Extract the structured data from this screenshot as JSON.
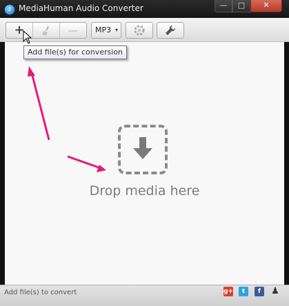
{
  "window": {
    "title": "MediaHuman Audio Converter",
    "controls": {
      "minimize": "—",
      "maximize": "□",
      "close": "✕"
    }
  },
  "toolbar": {
    "add_icon": "+",
    "clear_icon": "🧹",
    "remove_icon": "—",
    "format_value": "MP3",
    "format_caret": "▾",
    "convert_icon": "⚙",
    "settings_icon": "🔧"
  },
  "tooltip": {
    "text": "Add file(s) for conversion"
  },
  "main": {
    "drop_text": "Drop media here"
  },
  "statusbar": {
    "text": "Add file(s) to convert"
  },
  "social": {
    "gplus": "g+",
    "twitter": "t",
    "facebook": "f",
    "person": "♟"
  },
  "colors": {
    "annotation_arrow": "#e8197a",
    "close_button": "#c44a3a",
    "drop_icon": "#8a8a8a"
  }
}
